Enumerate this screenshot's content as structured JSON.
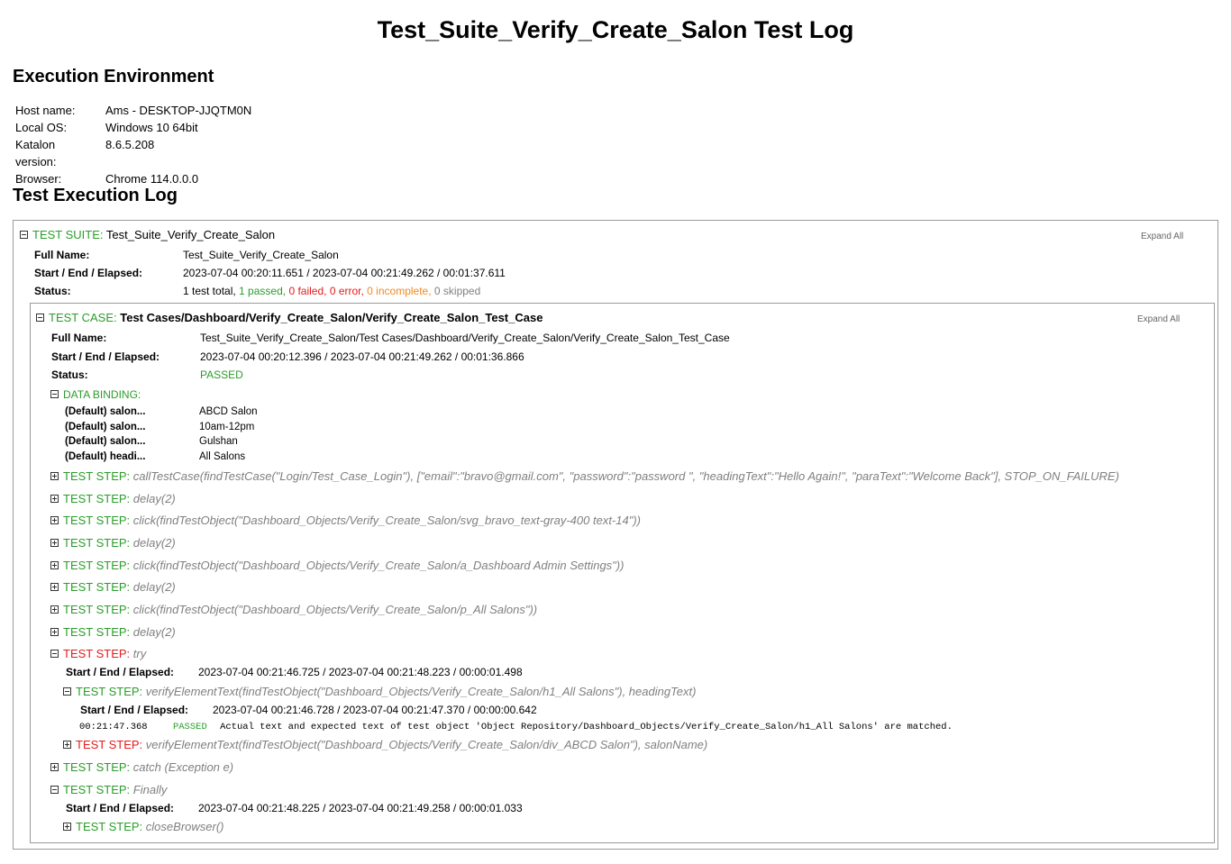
{
  "title": "Test_Suite_Verify_Create_Salon Test Log",
  "environment": {
    "heading": "Execution Environment",
    "rows": [
      {
        "key": "Host name:",
        "value": "Ams - DESKTOP-JJQTM0N"
      },
      {
        "key": "Local OS:",
        "value": "Windows 10 64bit"
      },
      {
        "key": "Katalon version:",
        "value": "8.6.5.208"
      },
      {
        "key": "Browser:",
        "value": "Chrome 114.0.0.0"
      }
    ]
  },
  "log": {
    "heading": "Test Execution Log",
    "expand_all": "Expand All",
    "labels": {
      "full_name": "Full Name:",
      "start_end": "Start / End / Elapsed:",
      "status": "Status:",
      "test_suite": "TEST SUITE:",
      "test_case": "TEST CASE:",
      "test_step": "TEST STEP:",
      "data_binding": "DATA BINDING:"
    },
    "suite": {
      "name": "Test_Suite_Verify_Create_Salon",
      "full_name": "Test_Suite_Verify_Create_Salon",
      "start_end": "2023-07-04 00:20:11.651 / 2023-07-04 00:21:49.262 / 00:01:37.611",
      "status": {
        "total": "1 test total,",
        "passed": "1 passed,",
        "failed": "0 failed,",
        "error": "0 error,",
        "incomplete": "0 incomplete,",
        "skipped": "0 skipped"
      }
    },
    "case": {
      "name": "Test Cases/Dashboard/Verify_Create_Salon/Verify_Create_Salon_Test_Case",
      "full_name": "Test_Suite_Verify_Create_Salon/Test Cases/Dashboard/Verify_Create_Salon/Verify_Create_Salon_Test_Case",
      "start_end": "2023-07-04 00:20:12.396 / 2023-07-04 00:21:49.262 / 00:01:36.866",
      "status": "PASSED",
      "bindings": [
        {
          "key": "(Default) salon...",
          "value": "ABCD Salon"
        },
        {
          "key": "(Default) salon...",
          "value": "10am-12pm"
        },
        {
          "key": "(Default) salon...",
          "value": "Gulshan"
        },
        {
          "key": "(Default) headi...",
          "value": "All Salons"
        }
      ]
    },
    "steps": {
      "s1": "callTestCase(findTestCase(\"Login/Test_Case_Login\"), [\"email\":\"bravo@gmail.com\", \"password\":\"password \", \"headingText\":\"Hello Again!\", \"paraText\":\"Welcome Back\"], STOP_ON_FAILURE)",
      "s2": "delay(2)",
      "s3": "click(findTestObject(\"Dashboard_Objects/Verify_Create_Salon/svg_bravo_text-gray-400 text-14\"))",
      "s4": "delay(2)",
      "s5": "click(findTestObject(\"Dashboard_Objects/Verify_Create_Salon/a_Dashboard Admin Settings\"))",
      "s6": "delay(2)",
      "s7": "click(findTestObject(\"Dashboard_Objects/Verify_Create_Salon/p_All Salons\"))",
      "s8": "delay(2)",
      "try": {
        "text": "try",
        "start_end": "2023-07-04 00:21:46.725 / 2023-07-04 00:21:48.223 / 00:00:01.498",
        "verify1": {
          "text": "verifyElementText(findTestObject(\"Dashboard_Objects/Verify_Create_Salon/h1_All Salons\"), headingText)",
          "start_end": "2023-07-04 00:21:46.728 / 2023-07-04 00:21:47.370 / 00:00:00.642",
          "msg_time": "00:21:47.368",
          "msg_status": "PASSED",
          "msg_text": "Actual text and expected text of test object 'Object Repository/Dashboard_Objects/Verify_Create_Salon/h1_All Salons' are matched."
        },
        "verify2": "verifyElementText(findTestObject(\"Dashboard_Objects/Verify_Create_Salon/div_ABCD Salon\"), salonName)"
      },
      "catch": "catch (Exception e)",
      "finally": {
        "text": "Finally",
        "start_end": "2023-07-04 00:21:48.225 / 2023-07-04 00:21:49.258 / 00:00:01.033",
        "close": "closeBrowser()"
      }
    }
  },
  "colors": {
    "pass": "#2a9d2a",
    "fail": "#e31b1b",
    "incomplete": "#f08a24",
    "muted": "#808080"
  }
}
